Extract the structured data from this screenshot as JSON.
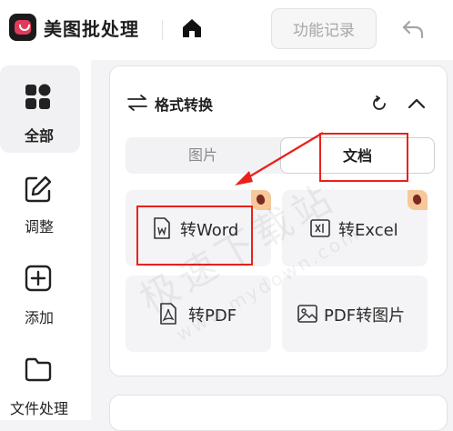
{
  "app": {
    "title": "美图批处理"
  },
  "header": {
    "history_label": "功能记录"
  },
  "sidebar": {
    "items": [
      {
        "label": "全部",
        "icon": "grid-icon",
        "active": true
      },
      {
        "label": "调整",
        "icon": "edit-icon"
      },
      {
        "label": "添加",
        "icon": "add-icon"
      },
      {
        "label": "文件处理",
        "icon": "folder-icon"
      }
    ]
  },
  "panel": {
    "title": "格式转换",
    "tabs": [
      {
        "label": "图片",
        "active": false
      },
      {
        "label": "文档",
        "active": true
      }
    ],
    "cards": [
      {
        "label": "转Word",
        "icon": "word-icon",
        "badge": true
      },
      {
        "label": "转Excel",
        "icon": "excel-icon",
        "badge": true
      },
      {
        "label": "转PDF",
        "icon": "pdf-icon",
        "badge": false
      },
      {
        "label": "PDF转图片",
        "icon": "image-icon",
        "badge": false
      }
    ]
  },
  "watermark": {
    "text": "极速下载站",
    "subtext": "www.mydown.com"
  },
  "colors": {
    "annotation": "#e8221b",
    "badge": "#f6c89a",
    "logo_accent": "#e23b5a"
  }
}
